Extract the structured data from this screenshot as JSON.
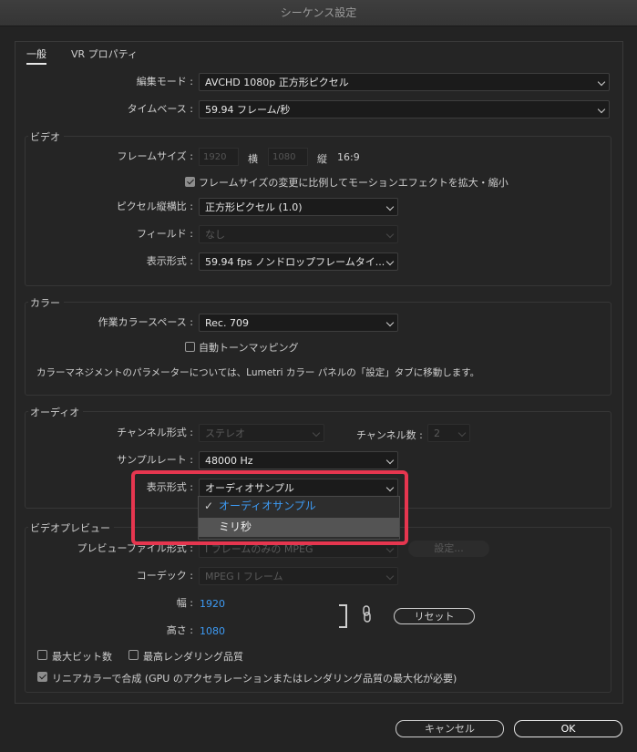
{
  "window": {
    "title": "シーケンス設定"
  },
  "tabs": [
    "一般",
    "VR プロパティ"
  ],
  "general": {
    "editing_mode_label": "編集モード :",
    "editing_mode_value": "AVCHD 1080p 正方形ピクセル",
    "timebase_label": "タイムベース :",
    "timebase_value": "59.94  フレーム/秒"
  },
  "video": {
    "title": "ビデオ",
    "frame_size_label": "フレームサイズ :",
    "frame_width": "1920",
    "frame_width_unit": "横",
    "frame_height": "1080",
    "frame_height_unit": "縦",
    "aspect": "16:9",
    "scale_checkbox": "フレームサイズの変更に比例してモーションエフェクトを拡大・縮小",
    "pixel_aspect_label": "ピクセル縦横比 :",
    "pixel_aspect_value": "正方形ピクセル (1.0)",
    "field_label": "フィールド :",
    "field_value": "なし",
    "display_format_label": "表示形式 :",
    "display_format_value": "59.94 fps ノンドロップフレームタイ..."
  },
  "color": {
    "title": "カラー",
    "working_space_label": "作業カラースペース :",
    "working_space_value": "Rec. 709",
    "auto_tone_label": "自動トーンマッピング",
    "note": "カラーマネジメントのパラメーターについては、Lumetri カラー パネルの「設定」タブに移動します。"
  },
  "audio": {
    "title": "オーディオ",
    "channel_format_label": "チャンネル形式 :",
    "channel_format_value": "ステレオ",
    "channel_count_label": "チャンネル数 :",
    "channel_count_value": "2",
    "sample_rate_label": "サンプルレート :",
    "sample_rate_value": "48000 Hz",
    "display_format_label": "表示形式 :",
    "display_format_value": "オーディオサンプル",
    "dropdown_options": [
      "オーディオサンプル",
      "ミリ秒"
    ],
    "selected_mark": "✓"
  },
  "preview": {
    "title": "ビデオプレビュー",
    "file_format_label": "プレビューファイル形式 :",
    "file_format_value": "I フレームのみの MPEG",
    "settings_button": "設定...",
    "codec_label": "コーデック :",
    "codec_value": "MPEG I フレーム",
    "width_label": "幅 :",
    "width_value": "1920",
    "height_label": "高さ :",
    "height_value": "1080",
    "reset_button": "リセット",
    "max_bit_depth": "最大ビット数",
    "max_render_quality": "最高レンダリング品質",
    "linear_color": "リニアカラーで合成 (GPU のアクセラレーションまたはレンダリング品質の最大化が必要)"
  },
  "footer": {
    "cancel": "キャンセル",
    "ok": "OK"
  },
  "colors": {
    "highlight_border": "#e6364f",
    "accent_blue": "#3d9bf5"
  }
}
